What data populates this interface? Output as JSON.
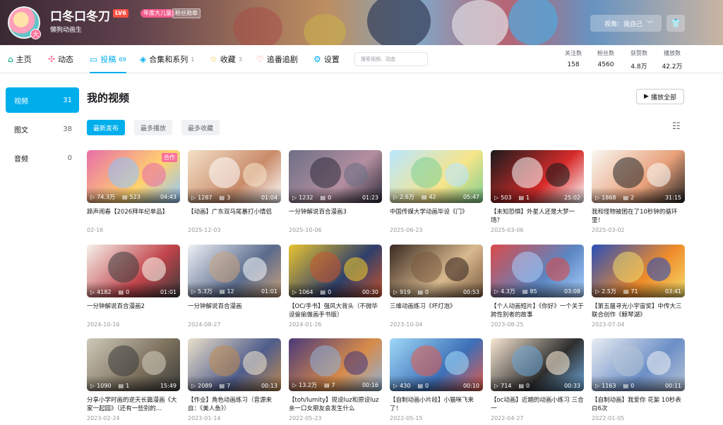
{
  "header": {
    "username": "口冬口冬刀",
    "level": "LV6",
    "vip_badge": "年度大儿童",
    "fans_medal": "粉丝勋章",
    "sign": "懒狗动画生",
    "view_select": "视角：我自己",
    "avatar_badge": "大"
  },
  "nav": {
    "tabs": [
      {
        "label": "主页",
        "icon": "home-icon",
        "count": ""
      },
      {
        "label": "动态",
        "icon": "dynamic-icon",
        "count": ""
      },
      {
        "label": "投稿",
        "icon": "video-icon",
        "count": "69"
      },
      {
        "label": "合集和系列",
        "icon": "collection-icon",
        "count": "1"
      },
      {
        "label": "收藏",
        "icon": "star-icon",
        "count": "3"
      },
      {
        "label": "追番追剧",
        "icon": "heart-icon",
        "count": ""
      },
      {
        "label": "设置",
        "icon": "settings-icon",
        "count": ""
      }
    ],
    "search_placeholder": "搜索视频、动态",
    "stats": [
      {
        "label": "关注数",
        "value": "158"
      },
      {
        "label": "粉丝数",
        "value": "4560"
      },
      {
        "label": "获赞数",
        "value": "4.8万"
      },
      {
        "label": "播放数",
        "value": "42.2万"
      }
    ]
  },
  "sidebar": {
    "items": [
      {
        "label": "视频",
        "count": "31"
      },
      {
        "label": "图文",
        "count": "38"
      },
      {
        "label": "音频",
        "count": "0"
      }
    ]
  },
  "main": {
    "title": "我的视频",
    "play_all": "播放全部",
    "sort": [
      "最新发布",
      "最多播放",
      "最多收藏"
    ]
  },
  "videos": [
    {
      "title": "蹄声闹春【2026拜年纪单品】",
      "date": "02-16",
      "plays": "74.3万",
      "comments": "523",
      "duration": "04:43",
      "tag": "合作"
    },
    {
      "title": "【动画】广东双马尾暴打小情侣",
      "date": "2025-12-03",
      "plays": "1287",
      "comments": "3",
      "duration": "01:04",
      "tag": ""
    },
    {
      "title": "一分钟解说百合漫画3",
      "date": "2025-10-06",
      "plays": "1232",
      "comments": "0",
      "duration": "01:23",
      "tag": ""
    },
    {
      "title": "中国传媒大学动画毕设《门》",
      "date": "2025-06-23",
      "plays": "2.6万",
      "comments": "42",
      "duration": "05:47",
      "tag": ""
    },
    {
      "title": "【未知恐惧】外星人还是大梦一场？",
      "date": "2025-03-06",
      "plays": "503",
      "comments": "1",
      "duration": "25:02",
      "tag": ""
    },
    {
      "title": "我和怪物被困在了10秒钟的循环里！",
      "date": "2025-03-02",
      "plays": "1868",
      "comments": "2",
      "duration": "31:15",
      "tag": ""
    },
    {
      "title": "一分钟解说百合漫画2",
      "date": "2024-10-16",
      "plays": "4182",
      "comments": "0",
      "duration": "01:01",
      "tag": ""
    },
    {
      "title": "一分钟解说百合漫画",
      "date": "2024-08-27",
      "plays": "5.3万",
      "comments": "12",
      "duration": "01:01",
      "tag": ""
    },
    {
      "title": "【OC/手书】强风大背头（不微毕设偷偷做画手书版）",
      "date": "2024-01-26",
      "plays": "1064",
      "comments": "0",
      "duration": "00:30",
      "tag": ""
    },
    {
      "title": "三维动画练习《坏灯泡》",
      "date": "2023-10-04",
      "plays": "919",
      "comments": "0",
      "duration": "00:53",
      "tag": ""
    },
    {
      "title": "【个人动画短片】《你好》一个关于跨性别者的故事",
      "date": "2023-08-25",
      "plays": "4.3万",
      "comments": "85",
      "duration": "03:08",
      "tag": ""
    },
    {
      "title": "【第五届寻光小宇宙奖】中传大三联合创作《鲸琴湖》",
      "date": "2023-07-04",
      "plays": "2.5万",
      "comments": "71",
      "duration": "03:41",
      "tag": ""
    },
    {
      "title": "分享小学时画的逆天长篇漫画《大家一起园》（还有一些别的…",
      "date": "2023-02-24",
      "plays": "1090",
      "comments": "1",
      "duration": "15:49",
      "tag": ""
    },
    {
      "title": "【作业】角色动画练习（音源来自：《美人鱼》）",
      "date": "2023-01-14",
      "plays": "2089",
      "comments": "7",
      "duration": "00:13",
      "tag": ""
    },
    {
      "title": "【toh/lumity】现设luz和原设luz亲一口女朋友会发生什么",
      "date": "2022-05-23",
      "plays": "13.2万",
      "comments": "7",
      "duration": "00:16",
      "tag": ""
    },
    {
      "title": "【自制动画小片段】小猫咪飞来了！",
      "date": "2022-05-15",
      "plays": "430",
      "comments": "0",
      "duration": "00:10",
      "tag": ""
    },
    {
      "title": "【oc动画】近期的动画小练习 三合一",
      "date": "2022-04-27",
      "plays": "714",
      "comments": "0",
      "duration": "00:33",
      "tag": ""
    },
    {
      "title": "【自制动画】我爱你 花絮 10秒表白6次",
      "date": "2022-01-05",
      "plays": "1163",
      "comments": "0",
      "duration": "00:11",
      "tag": ""
    }
  ],
  "thumb_colors": [
    [
      "#e86fa8",
      "#ffd36e",
      "#8ec5ff"
    ],
    [
      "#f3e1c7",
      "#c98b6a",
      "#ffffff"
    ],
    [
      "#6e6f86",
      "#b48fa0",
      "#2d2b3a"
    ],
    [
      "#b9e6ff",
      "#f7e58a",
      "#7ccf8f"
    ],
    [
      "#1b1b1b",
      "#d72b2b",
      "#ffffff"
    ],
    [
      "#f9f7f2",
      "#e8a07a",
      "#222222"
    ],
    [
      "#f6f1ea",
      "#c1444b",
      "#3a3a3a"
    ],
    [
      "#eef1f6",
      "#5a6b8c",
      "#c9a27d"
    ],
    [
      "#e9c431",
      "#2f3f6a",
      "#c8542f"
    ],
    [
      "#3a2a22",
      "#d8b98e",
      "#7a5a40"
    ],
    [
      "#d94b4b",
      "#5b86c2",
      "#a8d0ff"
    ],
    [
      "#2a4fb8",
      "#f08c2a",
      "#f3dd6b"
    ],
    [
      "#cfc9b9",
      "#7a6f5b",
      "#3b3b3b"
    ],
    [
      "#eadfca",
      "#4f5d8c",
      "#c08b52"
    ],
    [
      "#4b3a7a",
      "#d88b4a",
      "#8fb3d8"
    ],
    [
      "#9fd8f6",
      "#3d6fb8",
      "#e45b4b"
    ],
    [
      "#f7e7d2",
      "#2e2e2e",
      "#6da7d8"
    ],
    [
      "#e9edf2",
      "#6c8fc7",
      "#b7c4d6"
    ]
  ]
}
